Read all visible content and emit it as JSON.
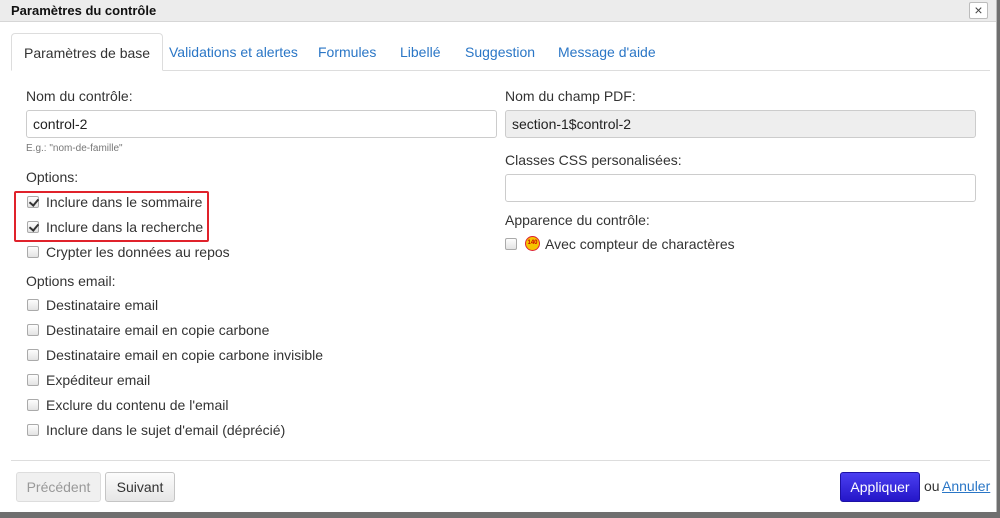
{
  "dialog": {
    "title": "Paramètres du contrôle",
    "close_label": "×"
  },
  "tabs": [
    {
      "label": "Paramètres de base",
      "active": true
    },
    {
      "label": "Validations et alertes"
    },
    {
      "label": "Formules"
    },
    {
      "label": "Libellé"
    },
    {
      "label": "Suggestion"
    },
    {
      "label": "Message d'aide"
    }
  ],
  "left": {
    "name_label": "Nom du contrôle:",
    "name_value": "control-2",
    "name_hint": "E.g.: \"nom-de-famille\"",
    "options_label": "Options:",
    "options": [
      {
        "label": "Inclure dans le sommaire",
        "checked": true
      },
      {
        "label": "Inclure dans la recherche",
        "checked": true
      },
      {
        "label": "Crypter les données au repos",
        "checked": false
      }
    ],
    "email_label": "Options email:",
    "email_options": [
      {
        "label": "Destinataire email",
        "checked": false
      },
      {
        "label": "Destinataire email en copie carbone",
        "checked": false
      },
      {
        "label": "Destinataire email en copie carbone invisible",
        "checked": false
      },
      {
        "label": "Expéditeur email",
        "checked": false
      },
      {
        "label": "Exclure du contenu de l'email",
        "checked": false
      },
      {
        "label": "Inclure dans le sujet d'email (déprécié)",
        "checked": false
      }
    ]
  },
  "right": {
    "pdf_label": "Nom du champ PDF:",
    "pdf_value": "section-1$control-2",
    "css_label": "Classes CSS personalisées:",
    "css_value": "",
    "appearance_label": "Apparence du contrôle:",
    "counter_label": "Avec compteur de charactères",
    "counter_checked": false,
    "counter_icon": "character-counter-icon",
    "counter_icon_text": "140"
  },
  "footer": {
    "prev_label": "Précédent",
    "next_label": "Suivant",
    "apply_label": "Appliquer",
    "or_text": "ou",
    "cancel_label": "Annuler"
  },
  "colors": {
    "link": "#2a76c6",
    "primary": "#2b1ed6",
    "highlight": "#e0222b"
  }
}
